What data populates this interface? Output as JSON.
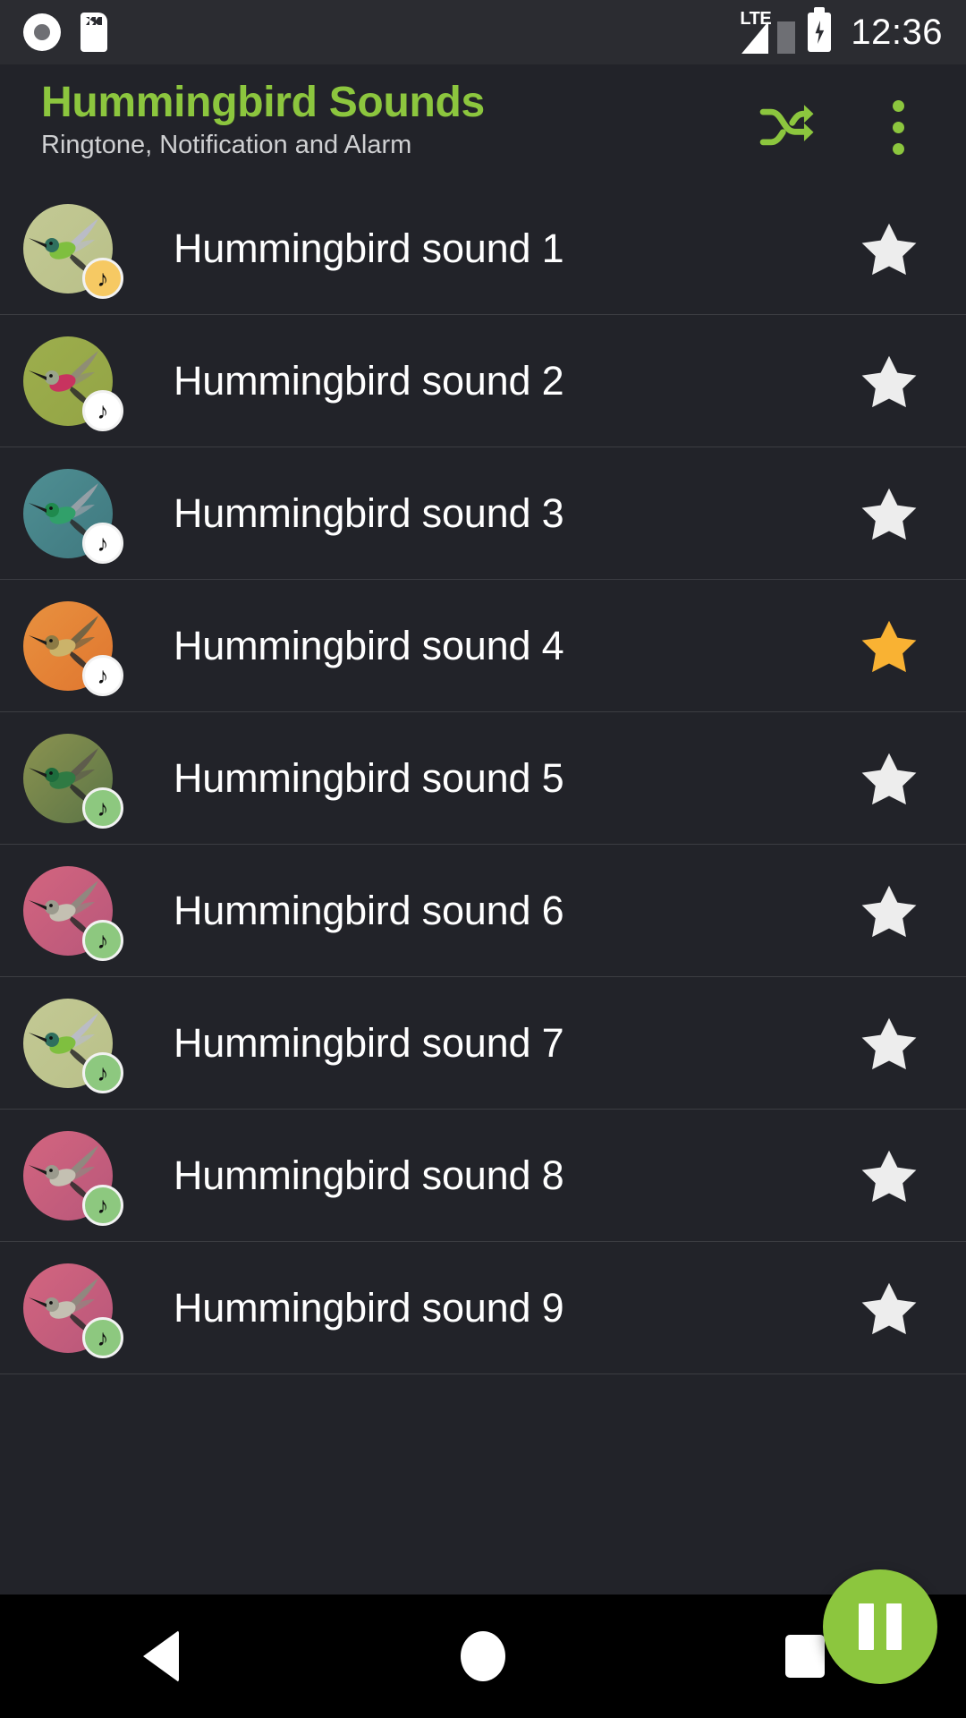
{
  "status_bar": {
    "icons": [
      "record-icon",
      "sd-card-icon"
    ],
    "network_label": "LTE",
    "clock": "12:36",
    "battery": "charging"
  },
  "app_bar": {
    "title": "Hummingbird Sounds",
    "subtitle": "Ringtone, Notification and Alarm",
    "title_color": "#8CC63E",
    "shuffle_icon": "shuffle-icon",
    "overflow_icon": "overflow-menu-icon"
  },
  "colors": {
    "accent_green": "#8CC63E",
    "star_on": "#F9B233",
    "star_off": "#EDEDED",
    "badge_alarm": "#F6C963",
    "badge_notification": "#FFFFFF",
    "badge_ringtone": "#8DC87F",
    "background": "#222329",
    "divider": "#3C3D42"
  },
  "list": {
    "items": [
      {
        "title": "Hummingbird sound 1",
        "badge": "alarm",
        "badge_color": "#F6C963",
        "starred": false,
        "thumb": "hummingbird-flying-olive"
      },
      {
        "title": "Hummingbird sound 2",
        "badge": "notification",
        "badge_color": "#FFFFFF",
        "starred": false,
        "thumb": "hummingbird-pink-throat-olive"
      },
      {
        "title": "Hummingbird sound 3",
        "badge": "notification",
        "badge_color": "#FFFFFF",
        "starred": false,
        "thumb": "hummingbird-green-teal"
      },
      {
        "title": "Hummingbird sound 4",
        "badge": "notification",
        "badge_color": "#FFFFFF",
        "starred": true,
        "thumb": "hummingbird-orange-flower"
      },
      {
        "title": "Hummingbird sound 5",
        "badge": "ringtone",
        "badge_color": "#8DC87F",
        "starred": false,
        "thumb": "hummingbird-green-dark"
      },
      {
        "title": "Hummingbird sound 6",
        "badge": "ringtone",
        "badge_color": "#8DC87F",
        "starred": false,
        "thumb": "hummingbird-pink-blossom"
      },
      {
        "title": "Hummingbird sound 7",
        "badge": "ringtone",
        "badge_color": "#8DC87F",
        "starred": false,
        "thumb": "hummingbird-flying-olive"
      },
      {
        "title": "Hummingbird sound 8",
        "badge": "ringtone",
        "badge_color": "#8DC87F",
        "starred": false,
        "thumb": "hummingbird-pink-blossom"
      },
      {
        "title": "Hummingbird sound 9",
        "badge": "ringtone",
        "badge_color": "#8DC87F",
        "starred": false,
        "thumb": "hummingbird-pink-blossom"
      }
    ],
    "note_glyph": "♪"
  },
  "fab": {
    "state": "pause",
    "icon": "pause-icon",
    "color": "#8CC63E"
  },
  "nav_bar": {
    "back": "back-button",
    "home": "home-button",
    "recents": "recents-button"
  }
}
